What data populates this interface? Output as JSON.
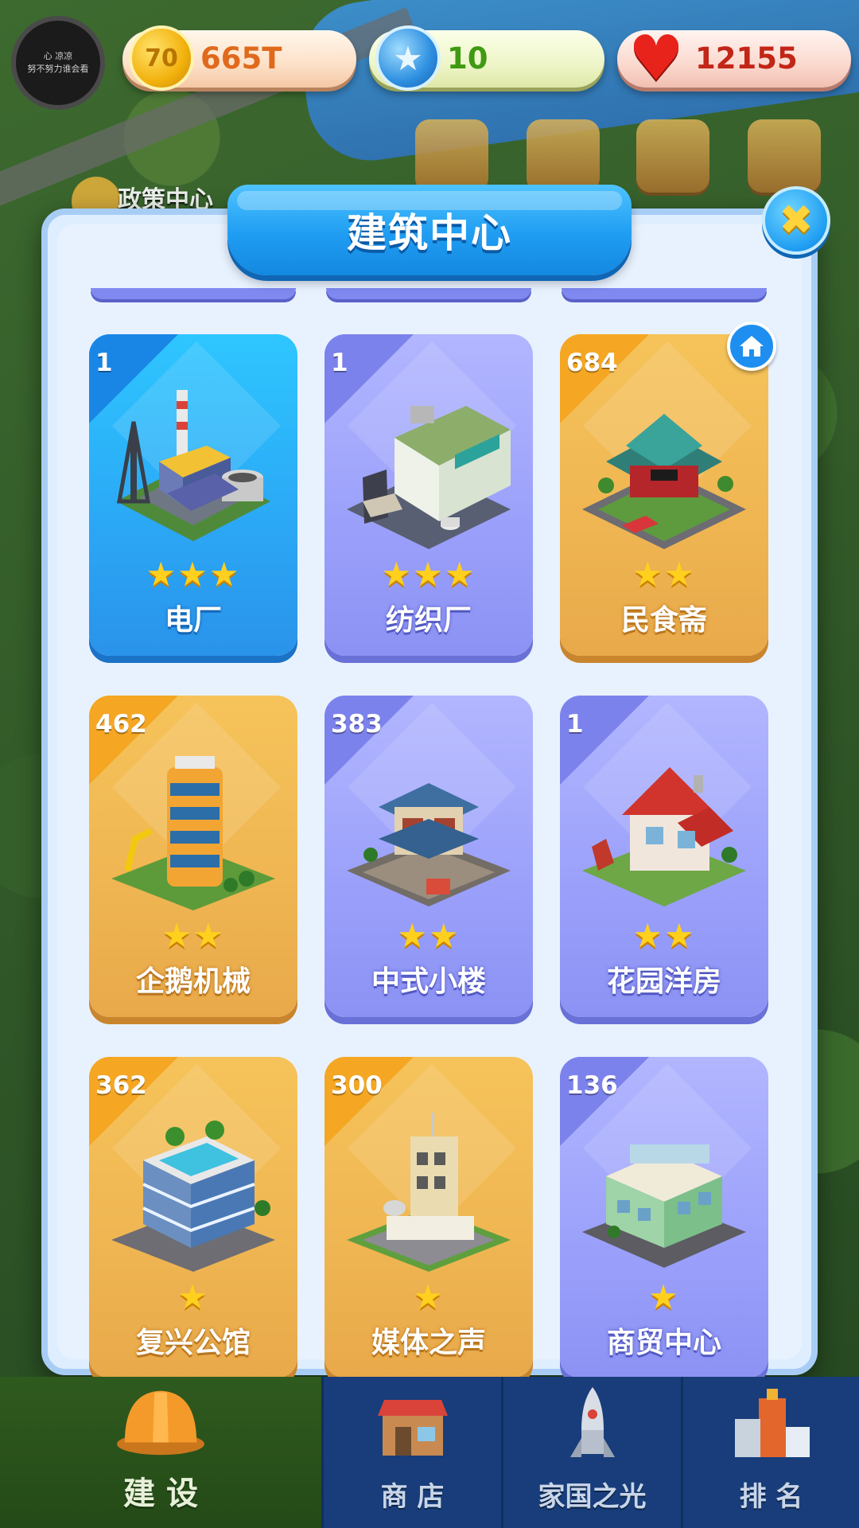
{
  "topbar": {
    "avatar_text_line1": "心 凉凉",
    "avatar_text_line2": "努不努力谁会看",
    "coins": "665T",
    "coin_symbol": "70",
    "gems": "10",
    "hearts": "12155"
  },
  "background": {
    "policy_label": "政策中心"
  },
  "dialog": {
    "title": "建筑中心",
    "close_icon": "✖",
    "cards": [
      {
        "count": "1",
        "name": "电厂",
        "stars": "★★★",
        "theme": "blue"
      },
      {
        "count": "1",
        "name": "纺织厂",
        "stars": "★★★",
        "theme": "purple"
      },
      {
        "count": "684",
        "name": "民食斋",
        "stars": "★★",
        "theme": "gold"
      },
      {
        "count": "462",
        "name": "企鹅机械",
        "stars": "★★",
        "theme": "gold"
      },
      {
        "count": "383",
        "name": "中式小楼",
        "stars": "★★",
        "theme": "purple"
      },
      {
        "count": "1",
        "name": "花园洋房",
        "stars": "★★",
        "theme": "purple"
      },
      {
        "count": "362",
        "name": "复兴公馆",
        "stars": "★",
        "theme": "gold"
      },
      {
        "count": "300",
        "name": "媒体之声",
        "stars": "★",
        "theme": "gold"
      },
      {
        "count": "136",
        "name": "商贸中心",
        "stars": "★",
        "theme": "purple"
      }
    ]
  },
  "nav": {
    "items": [
      {
        "label": "建 设",
        "icon": "hard-hat-icon",
        "active": true
      },
      {
        "label": "商 店",
        "icon": "shop-icon"
      },
      {
        "label": "家国之光",
        "icon": "rocket-icon"
      },
      {
        "label": "排 名",
        "icon": "podium-icon"
      }
    ]
  },
  "colors": {
    "card_blue": "#2ba7f5",
    "card_purple": "#9aa0fa",
    "card_gold": "#efb552",
    "accent": "#1f9df2",
    "star": "#ffd01e"
  }
}
